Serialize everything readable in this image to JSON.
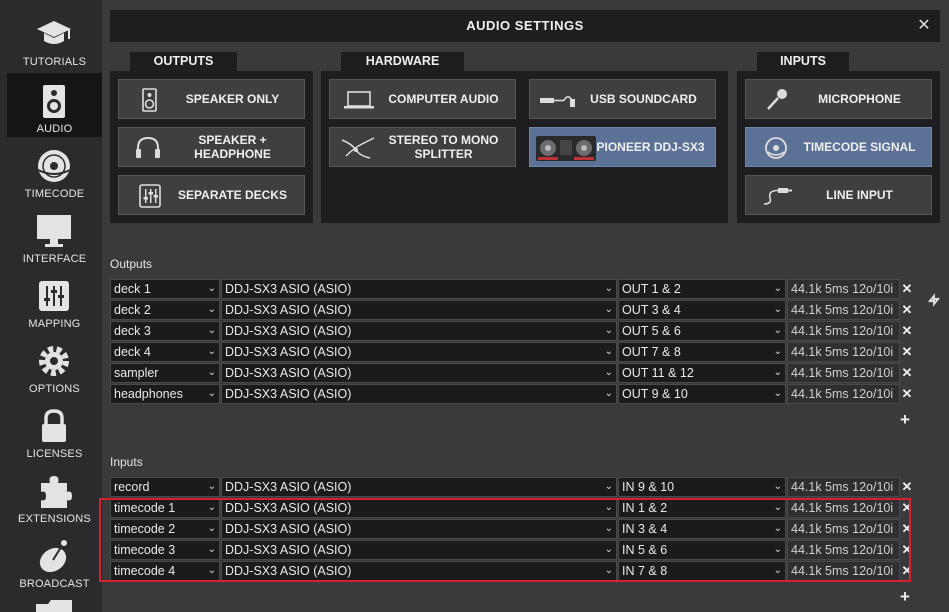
{
  "sidebar": {
    "items": [
      {
        "label": "TUTORIALS",
        "icon": "graduation-cap-icon"
      },
      {
        "label": "AUDIO",
        "icon": "speaker-icon",
        "active": true
      },
      {
        "label": "TIMECODE",
        "icon": "vinyl-icon"
      },
      {
        "label": "INTERFACE",
        "icon": "monitor-icon"
      },
      {
        "label": "MAPPING",
        "icon": "sliders-icon"
      },
      {
        "label": "OPTIONS",
        "icon": "gear-icon"
      },
      {
        "label": "LICENSES",
        "icon": "lock-icon"
      },
      {
        "label": "EXTENSIONS",
        "icon": "puzzle-icon"
      },
      {
        "label": "BROADCAST",
        "icon": "satellite-dish-icon"
      }
    ]
  },
  "dialog": {
    "title": "AUDIO SETTINGS",
    "close_glyph": "✕"
  },
  "tabs": {
    "outputs": "OUTPUTS",
    "hardware": "HARDWARE",
    "inputs": "INPUTS"
  },
  "outputs_buttons": [
    {
      "label": "SPEAKER ONLY",
      "icon": "speaker-icon"
    },
    {
      "label": "SPEAKER + HEADPHONE",
      "icon": "headphones-icon"
    },
    {
      "label": "SEPARATE DECKS",
      "icon": "mixer-icon"
    }
  ],
  "hardware_buttons": [
    {
      "label": "COMPUTER AUDIO",
      "icon": "laptop-icon"
    },
    {
      "label": "USB SOUNDCARD",
      "icon": "usb-cable-icon"
    },
    {
      "label": "STEREO TO MONO SPLITTER",
      "icon": "splitter-cable-icon"
    },
    {
      "label": "PIONEER DDJ-SX3",
      "icon": "dj-controller-icon",
      "selected": true
    }
  ],
  "inputs_buttons": [
    {
      "label": "MICROPHONE",
      "icon": "microphone-icon"
    },
    {
      "label": "TIMECODE SIGNAL",
      "icon": "timecode-icon",
      "selected": true
    },
    {
      "label": "LINE INPUT",
      "icon": "rca-cable-icon"
    }
  ],
  "outputs_section": {
    "label": "Outputs",
    "rows": [
      {
        "name": "deck 1",
        "device": "DDJ-SX3 ASIO (ASIO)",
        "channels": "OUT 1 & 2",
        "info": "44.1k 5ms 12o/10i"
      },
      {
        "name": "deck 2",
        "device": "DDJ-SX3 ASIO (ASIO)",
        "channels": "OUT 3 & 4",
        "info": "44.1k 5ms 12o/10i"
      },
      {
        "name": "deck 3",
        "device": "DDJ-SX3 ASIO (ASIO)",
        "channels": "OUT 5 & 6",
        "info": "44.1k 5ms 12o/10i"
      },
      {
        "name": "deck 4",
        "device": "DDJ-SX3 ASIO (ASIO)",
        "channels": "OUT 7 & 8",
        "info": "44.1k 5ms 12o/10i"
      },
      {
        "name": "sampler",
        "device": "DDJ-SX3 ASIO (ASIO)",
        "channels": "OUT 11 & 12",
        "info": "44.1k 5ms 12o/10i"
      },
      {
        "name": "headphones",
        "device": "DDJ-SX3 ASIO (ASIO)",
        "channels": "OUT 9 & 10",
        "info": "44.1k 5ms 12o/10i"
      }
    ]
  },
  "inputs_section": {
    "label": "Inputs",
    "rows": [
      {
        "name": "record",
        "device": "DDJ-SX3 ASIO (ASIO)",
        "channels": "IN 9 & 10",
        "info": "44.1k 5ms 12o/10i"
      },
      {
        "name": "timecode 1",
        "device": "DDJ-SX3 ASIO (ASIO)",
        "channels": "IN 1 & 2",
        "info": "44.1k 5ms 12o/10i"
      },
      {
        "name": "timecode 2",
        "device": "DDJ-SX3 ASIO (ASIO)",
        "channels": "IN 3 & 4",
        "info": "44.1k 5ms 12o/10i"
      },
      {
        "name": "timecode 3",
        "device": "DDJ-SX3 ASIO (ASIO)",
        "channels": "IN 5 & 6",
        "info": "44.1k 5ms 12o/10i"
      },
      {
        "name": "timecode 4",
        "device": "DDJ-SX3 ASIO (ASIO)",
        "channels": "IN 7 & 8",
        "info": "44.1k 5ms 12o/10i"
      }
    ]
  },
  "glyphs": {
    "remove": "✕",
    "add": "+",
    "dropdown": "⌄"
  },
  "colors": {
    "selected_button": "#5c7196",
    "highlight_border": "#d4212b"
  }
}
